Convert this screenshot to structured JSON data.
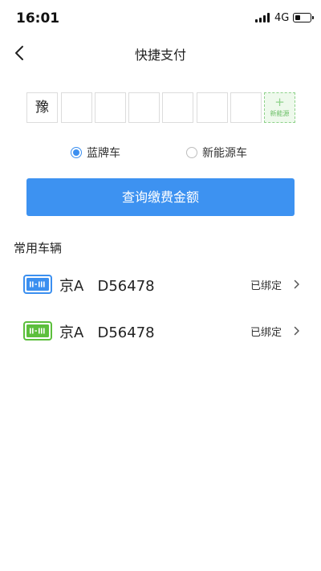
{
  "status_bar": {
    "time": "16:01",
    "network": "4G",
    "battery_level": 0.4
  },
  "nav": {
    "title": "快捷支付",
    "back_icon": "chevron-left-icon"
  },
  "plate_input": {
    "province": "豫",
    "chars": [
      "",
      "",
      "",
      "",
      "",
      ""
    ],
    "new_energy_plus": "+",
    "new_energy_label": "新能源"
  },
  "plate_types": [
    {
      "label": "蓝牌车",
      "checked": true
    },
    {
      "label": "新能源车",
      "checked": false
    }
  ],
  "query_button": {
    "label": "查询缴费金额"
  },
  "vehicles_section": {
    "title": "常用车辆",
    "items": [
      {
        "plate": "京A   D56478",
        "status": "已绑定",
        "icon": "blue-plate-icon",
        "color": "#3b8ff0"
      },
      {
        "plate": "京A   D56478",
        "status": "已绑定",
        "icon": "green-plate-icon",
        "color": "#5cbf3c"
      }
    ]
  },
  "colors": {
    "accent": "#3d92f1",
    "new_energy_green": "#8fd28b"
  }
}
